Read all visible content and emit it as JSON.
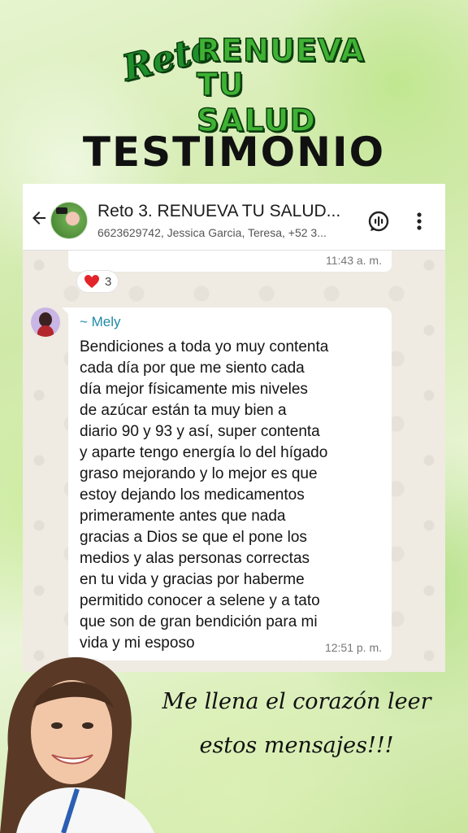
{
  "logo": {
    "reto": "Reto",
    "line1": "RENUEVA",
    "line2": "TU SALUD"
  },
  "headline": "TESTIMONIO",
  "chat": {
    "header": {
      "title": "Reto 3. RENUEVA TU SALUD...",
      "members": "6623629742, Jessica Garcia, Teresa, +52 3...",
      "icons": [
        "back-arrow-icon",
        "group-avatar",
        "voice-call-icon",
        "more-options-icon"
      ]
    },
    "previous_message": {
      "time": "11:43 a. m.",
      "reaction_count": "3"
    },
    "message": {
      "sender": "~ Mely",
      "text": "Bendiciones  a toda yo muy contenta\ncada día por que me siento cada\ndía mejor físicamente   mis niveles\nde azúcar están ta muy bien a\ndiario  90 y 93 y así, super contenta\ny aparte tengo  energía lo del hígado\ngraso mejorando y lo mejor es que\nestoy dejando los medicamentos\nprimeramente  antes que nada\ngracias  a Dios se que el pone los\nmedios y alas personas correctas\nen tu vida y gracias por haberme\npermitido conocer a selene y a tato\nque son de gran bendición  para mi\nvida y mi esposo",
      "time": "12:51 p. m."
    },
    "colors": {
      "chat_bg": "#efeae2",
      "bubble": "#ffffff",
      "sender_name": "#1f8aa8",
      "heart": "#e3242b"
    }
  },
  "caption": "Me llena el corazón leer estos mensajes!!!"
}
